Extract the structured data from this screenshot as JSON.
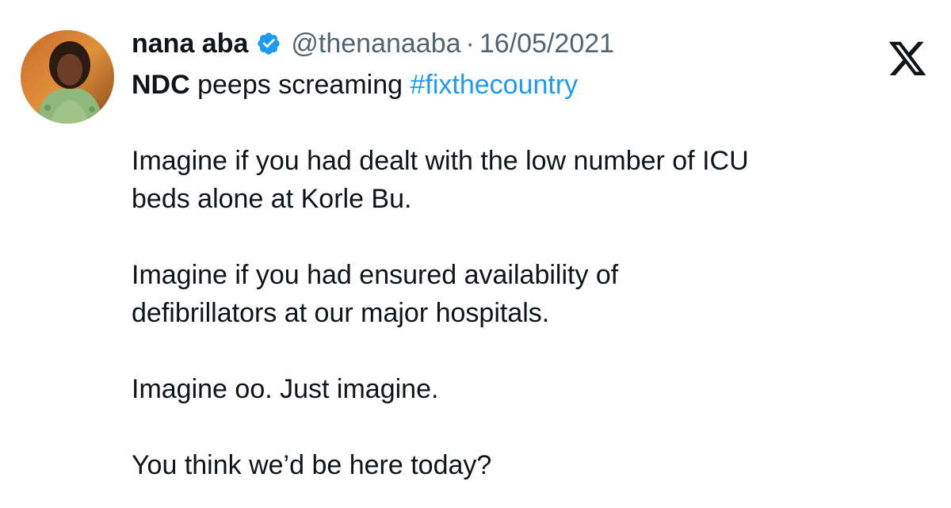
{
  "user": {
    "display_name": "nana aba",
    "handle": "@thenanaaba",
    "separator": "·",
    "date": "16/05/2021"
  },
  "icons": {
    "verified": "verified-badge-icon",
    "close": "x-logo-icon",
    "verified_color": "#1d9bf0"
  },
  "tweet": {
    "line1_bold": "NDC",
    "line1_text": " peeps screaming ",
    "hashtag": "#fixthecountry",
    "para1_line1": "Imagine if you had dealt with the low number of ICU",
    "para1_line2": "beds alone at Korle Bu.",
    "para2_line1": "Imagine if you had ensured availability of",
    "para2_line2": "defibrillators at our major hospitals.",
    "para3": "Imagine oo. Just imagine.",
    "para4": "You think we’d be here today?"
  }
}
